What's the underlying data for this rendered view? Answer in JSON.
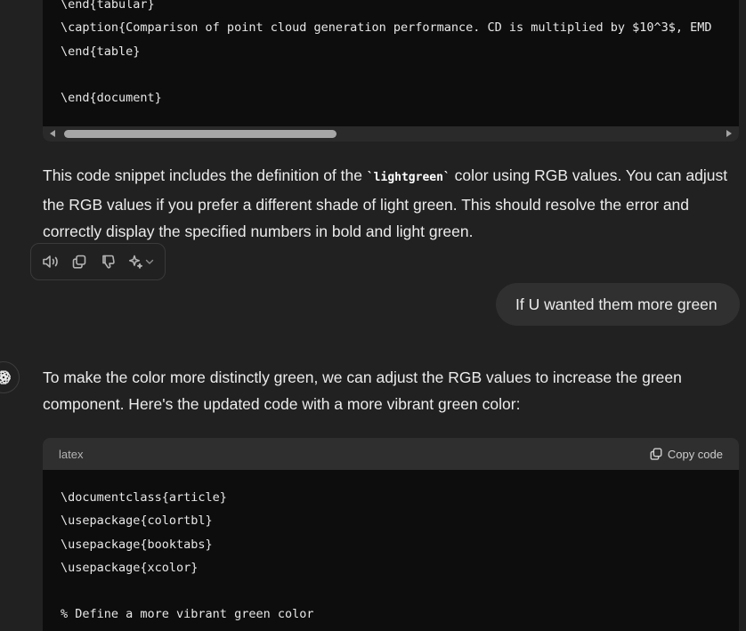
{
  "top_code": {
    "lines": [
      "\\end{tabular}",
      "\\caption{Comparison of point cloud generation performance. CD is multiplied by $10^3$, EMD",
      "\\end{table}",
      "",
      "\\end{document}"
    ]
  },
  "response1": {
    "text_before": "This code snippet includes the definition of the ",
    "code": "`lightgreen`",
    "text_after": " color using RGB values. You can adjust the RGB values if you prefer a different shade of light green. This should resolve the error and correctly display the specified numbers in bold and light green."
  },
  "actions": {
    "icons": [
      "read-aloud-icon",
      "copy-icon",
      "thumbs-down-icon",
      "sparkle-icon",
      "chevron-down-icon"
    ]
  },
  "user_message": "If U wanted them more green",
  "response2": {
    "text": "To make the color more distinctly green, we can adjust the RGB values to increase the green component. Here's the updated code with a more vibrant green color:"
  },
  "code_block": {
    "language": "latex",
    "copy_label": "Copy code",
    "lines": [
      "\\documentclass{article}",
      "\\usepackage{colortbl}",
      "\\usepackage{booktabs}",
      "\\usepackage{xcolor}",
      "",
      "% Define a more vibrant green color"
    ]
  },
  "colors": {
    "background": "#212121",
    "code_bg": "#0d0d0d",
    "bubble_bg": "#303030",
    "text": "#ececec"
  }
}
